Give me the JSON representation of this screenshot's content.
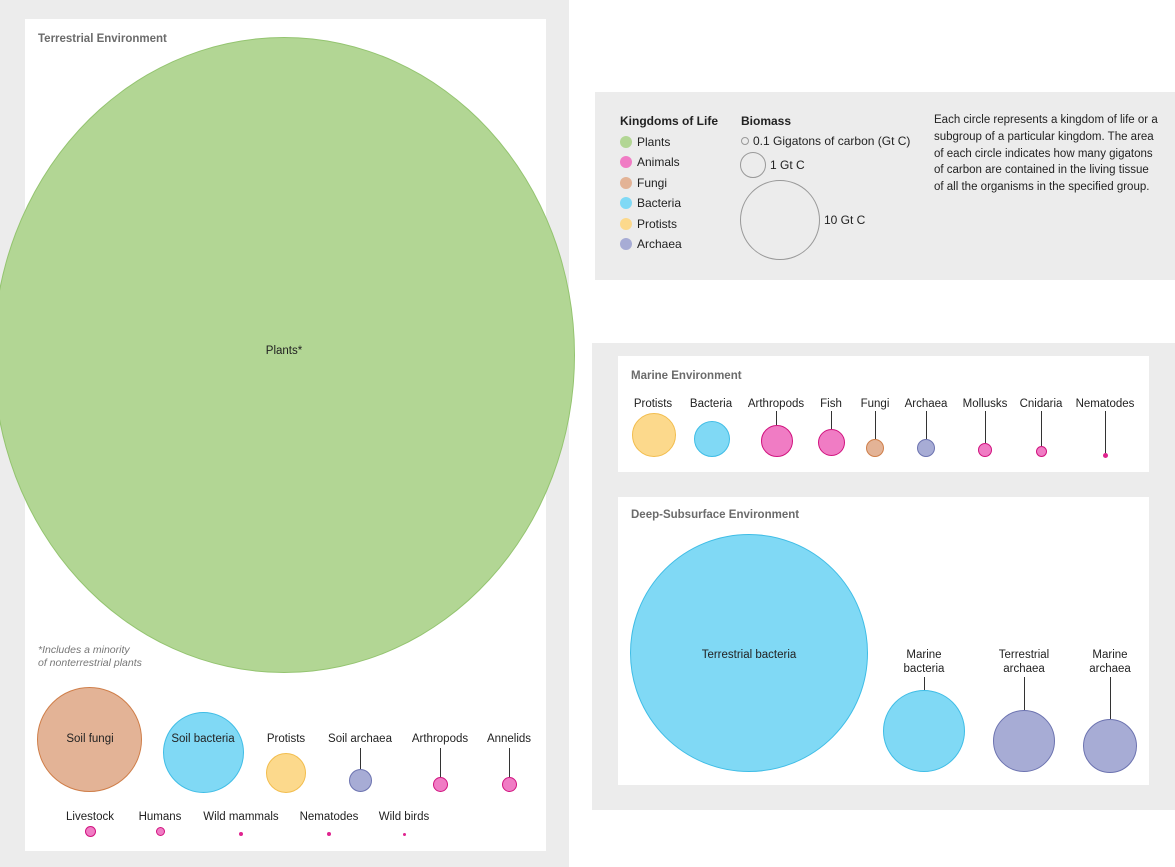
{
  "colors": {
    "plants": "#b2d694",
    "animals": "#f07cc4",
    "fungi": "#e3b396",
    "bacteria": "#80d9f5",
    "protists": "#fcd98c",
    "archaea": "#a7acd5",
    "panel_bg": "#ececec"
  },
  "terrestrial": {
    "title": "Terrestrial Environment",
    "note_line1": "*Includes a minority",
    "note_line2": "of nonterrestrial plants",
    "plants": "Plants*",
    "soil_fungi": "Soil fungi",
    "soil_bacteria": "Soil bacteria",
    "protists": "Protists",
    "soil_archaea": "Soil archaea",
    "arthropods": "Arthropods",
    "annelids": "Annelids",
    "livestock": "Livestock",
    "humans": "Humans",
    "wild_mammals": "Wild mammals",
    "nematodes": "Nematodes",
    "wild_birds": "Wild birds"
  },
  "legend": {
    "kingdoms_title": "Kingdoms of Life",
    "kingdoms": [
      "Plants",
      "Animals",
      "Fungi",
      "Bacteria",
      "Protists",
      "Archaea"
    ],
    "biomass_title": "Biomass",
    "scale_small": "0.1 Gigatons of carbon (Gt C)",
    "scale_mid": "1 Gt C",
    "scale_large": "10 Gt C",
    "description": "Each circle represents a kingdom of life or a subgroup of a particular kingdom. The area of each circle indicates how many gigatons of carbon are contained in the living tissue of all the organisms in the specified group."
  },
  "marine": {
    "title": "Marine Environment",
    "items": [
      "Protists",
      "Bacteria",
      "Arthropods",
      "Fish",
      "Fungi",
      "Archaea",
      "Mollusks",
      "Cnidaria",
      "Nematodes"
    ]
  },
  "deep": {
    "title": "Deep-Subsurface Environment",
    "terrestrial_bacteria": "Terrestrial bacteria",
    "marine_bacteria_1": "Marine",
    "marine_bacteria_2": "bacteria",
    "terrestrial_archaea_1": "Terrestrial",
    "terrestrial_archaea_2": "archaea",
    "marine_archaea_1": "Marine",
    "marine_archaea_2": "archaea"
  }
}
